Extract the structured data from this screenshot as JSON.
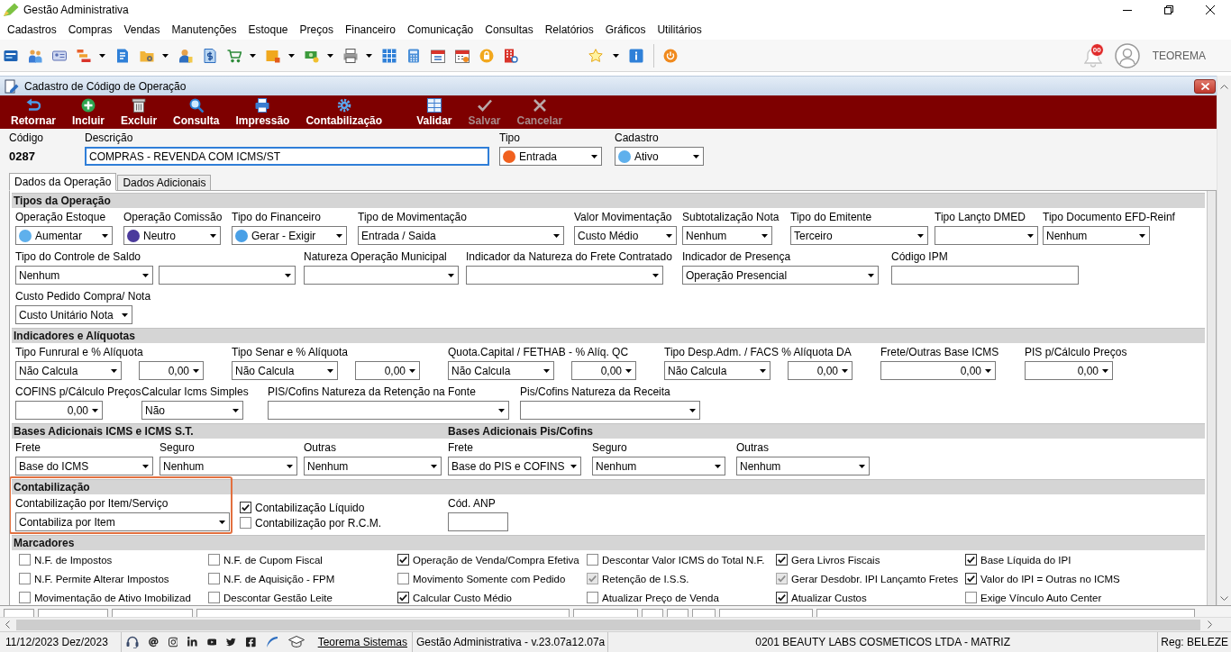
{
  "window": {
    "title": "Gestão Administrativa"
  },
  "menu": [
    "Cadastros",
    "Compras",
    "Vendas",
    "Manutenções",
    "Estoque",
    "Preços",
    "Financeiro",
    "Comunicação",
    "Consultas",
    "Relatórios",
    "Gráficos",
    "Utilitários"
  ],
  "toolbar": {
    "notification_count": "00",
    "user": "TEOREMA"
  },
  "form": {
    "title": "Cadastro de Código de Operação",
    "action_groups": [
      [
        {
          "label": "Retornar",
          "disabled": false
        },
        {
          "label": "Incluir",
          "disabled": false
        },
        {
          "label": "Excluir",
          "disabled": false
        },
        {
          "label": "Consulta",
          "disabled": false
        },
        {
          "label": "Impressão",
          "disabled": false
        },
        {
          "label": "Contabilização",
          "disabled": false
        }
      ],
      [
        {
          "label": "Validar",
          "disabled": false
        },
        {
          "label": "Salvar",
          "disabled": true
        },
        {
          "label": "Cancelar",
          "disabled": true
        }
      ]
    ],
    "code": {
      "label": "Código",
      "value": "0287"
    },
    "description": {
      "label": "Descrição",
      "value": "COMPRAS - REVENDA COM ICMS/ST",
      "focused": true
    },
    "type": {
      "label": "Tipo",
      "value": "Entrada",
      "color": "#f0601e"
    },
    "registry": {
      "label": "Cadastro",
      "value": "Ativo",
      "color": "#5fb0ec"
    },
    "tabs": [
      {
        "label": "Dados da Operação",
        "selected": true
      },
      {
        "label": "Dados Adicionais",
        "selected": false
      }
    ],
    "sections": [
      {
        "kind": "fields",
        "titles": [
          "Tipos da Operação"
        ],
        "lines": [
          {
            "fields": [
              {
                "kind": "field",
                "label": "Operação Estoque",
                "controls": [
                  {
                    "kind": "select",
                    "value": "Aumentar",
                    "color": "#5fb0ec"
                  }
                ]
              },
              {
                "kind": "field",
                "label": "Operação Comissão",
                "controls": [
                  {
                    "kind": "select",
                    "value": "Neutro",
                    "color": "#4b3a9c"
                  }
                ]
              },
              {
                "kind": "field",
                "label": "Tipo do Financeiro",
                "controls": [
                  {
                    "kind": "select",
                    "value": "Gerar - Exigir",
                    "color": "#4aa0e6"
                  }
                ]
              },
              {
                "kind": "field",
                "label": "Tipo de Movimentação",
                "controls": [
                  {
                    "kind": "select",
                    "value": "Entrada / Saida"
                  }
                ]
              },
              {
                "kind": "field",
                "label": "Valor Movimentação",
                "controls": [
                  {
                    "kind": "select",
                    "value": "Custo Médio"
                  }
                ]
              },
              {
                "kind": "field",
                "label": "Subtotalização Nota",
                "controls": [
                  {
                    "kind": "select",
                    "value": "Nenhum"
                  }
                ]
              },
              {
                "kind": "field",
                "label": "Tipo do Emitente",
                "controls": [
                  {
                    "kind": "select",
                    "value": "Terceiro"
                  }
                ]
              },
              {
                "kind": "field",
                "label": "Tipo Lançto DMED",
                "controls": [
                  {
                    "kind": "select"
                  }
                ]
              },
              {
                "kind": "field",
                "label": "Tipo Documento EFD-Reinf",
                "controls": [
                  {
                    "kind": "select",
                    "value": "Nenhum"
                  }
                ]
              }
            ]
          },
          {
            "fields": [
              {
                "kind": "field",
                "label": "Tipo do Controle de Saldo",
                "controls": [
                  {
                    "kind": "select",
                    "value": "Nenhum"
                  },
                  {
                    "kind": "select"
                  }
                ]
              },
              {
                "kind": "field",
                "label": "Natureza Operação Municipal",
                "controls": [
                  {
                    "kind": "select"
                  }
                ]
              },
              {
                "kind": "field",
                "label": "Indicador da Natureza do Frete Contratado",
                "controls": [
                  {
                    "kind": "select"
                  }
                ]
              },
              {
                "kind": "field",
                "label": "Indicador de Presença",
                "controls": [
                  {
                    "kind": "select",
                    "value": "Operação Presencial"
                  }
                ]
              },
              {
                "kind": "field",
                "label": "Código IPM",
                "controls": [
                  {
                    "kind": "text"
                  }
                ]
              }
            ]
          },
          {
            "fields": [
              {
                "kind": "field",
                "label": "Custo Pedido Compra/ Nota",
                "controls": [
                  {
                    "kind": "select",
                    "value": "Custo Unitário Nota"
                  }
                ]
              }
            ]
          }
        ]
      },
      {
        "kind": "fields",
        "titles": [
          "Indicadores e Alíquotas"
        ],
        "lines": [
          {
            "fields": [
              {
                "kind": "field",
                "label": "Tipo Funrural e % Alíquota",
                "controls": [
                  {
                    "kind": "select",
                    "value": "Não Calcula"
                  },
                  {
                    "kind": "number",
                    "value": "0,00"
                  }
                ]
              },
              {
                "kind": "field",
                "label": "Tipo Senar e % Alíquota",
                "controls": [
                  {
                    "kind": "select",
                    "value": "Não Calcula"
                  },
                  {
                    "kind": "number",
                    "value": "0,00"
                  }
                ]
              },
              {
                "kind": "field",
                "label": "Quota.Capital / FETHAB - % Alíq. QC",
                "controls": [
                  {
                    "kind": "select",
                    "value": "Não Calcula"
                  },
                  {
                    "kind": "number",
                    "value": "0,00"
                  }
                ]
              },
              {
                "kind": "field",
                "label": "Tipo Desp.Adm. / FACS % Alíquota DA",
                "controls": [
                  {
                    "kind": "select",
                    "value": "Não Calcula"
                  },
                  {
                    "kind": "number",
                    "value": "0,00"
                  }
                ]
              },
              {
                "kind": "field",
                "label": "Frete/Outras Base ICMS",
                "controls": [
                  {
                    "kind": "number",
                    "value": "0,00"
                  }
                ]
              },
              {
                "kind": "field",
                "label": "PIS p/Cálculo Preços",
                "controls": [
                  {
                    "kind": "number",
                    "value": "0,00"
                  }
                ]
              }
            ]
          },
          {
            "fields": [
              {
                "kind": "field",
                "label": "COFINS p/Cálculo Preços",
                "controls": [
                  {
                    "kind": "number",
                    "value": "0,00"
                  }
                ]
              },
              {
                "kind": "field",
                "label": "Calcular Icms Simples",
                "controls": [
                  {
                    "kind": "select",
                    "value": "Não"
                  }
                ]
              },
              {
                "kind": "field",
                "label": "PIS/Cofins Natureza da Retenção na Fonte",
                "controls": [
                  {
                    "kind": "select"
                  }
                ]
              },
              {
                "kind": "field",
                "label": "Pis/Cofins Natureza da Receita",
                "controls": [
                  {
                    "kind": "select"
                  }
                ]
              }
            ]
          }
        ]
      },
      {
        "kind": "fields",
        "titles": [
          "Bases Adicionais ICMS e ICMS S.T.",
          "Bases Adicionais Pis/Cofins"
        ],
        "lines": [
          {
            "fields": [
              {
                "kind": "field",
                "label": "Frete",
                "controls": [
                  {
                    "kind": "select",
                    "value": "Base do ICMS"
                  }
                ]
              },
              {
                "kind": "field",
                "label": "Seguro",
                "controls": [
                  {
                    "kind": "select",
                    "value": "Nenhum"
                  }
                ]
              },
              {
                "kind": "field",
                "label": "Outras",
                "controls": [
                  {
                    "kind": "select",
                    "value": "Nenhum"
                  }
                ]
              },
              {
                "kind": "field",
                "label": "Frete",
                "controls": [
                  {
                    "kind": "select",
                    "value": "Base do PIS e COFINS"
                  }
                ]
              },
              {
                "kind": "field",
                "label": "Seguro",
                "controls": [
                  {
                    "kind": "select",
                    "value": "Nenhum"
                  }
                ]
              },
              {
                "kind": "field",
                "label": "Outras",
                "controls": [
                  {
                    "kind": "select",
                    "value": "Nenhum"
                  }
                ]
              }
            ]
          }
        ]
      },
      {
        "kind": "fields",
        "titles": [
          "Contabilização"
        ],
        "highlight": true,
        "lines": [
          {
            "fields": [
              {
                "kind": "field",
                "label": "Contabilização por Item/Serviço",
                "controls": [
                  {
                    "kind": "select",
                    "value": "Contabiliza por Item"
                  }
                ]
              },
              {
                "kind": "checks",
                "items": [
                  {
                    "label": "Contabilização Líquido",
                    "checked": true
                  },
                  {
                    "label": "Contabilização por R.C.M.",
                    "checked": false
                  }
                ]
              },
              {
                "kind": "field",
                "label": "Cód. ANP",
                "controls": [
                  {
                    "kind": "text"
                  }
                ]
              }
            ]
          }
        ]
      },
      {
        "kind": "checkbox_grid",
        "titles": [
          "Marcadores"
        ],
        "rows": [
          [
            {
              "label": "N.F. de Impostos",
              "checked": false,
              "disabled": false
            },
            {
              "label": "N.F. de Cupom Fiscal",
              "checked": false,
              "disabled": false
            },
            {
              "label": "Operação de Venda/Compra Efetiva",
              "checked": true,
              "disabled": false
            },
            {
              "label": "Descontar Valor ICMS do Total N.F.",
              "checked": false,
              "disabled": false
            },
            {
              "label": "Gera Livros Fiscais",
              "checked": true,
              "disabled": false
            },
            {
              "label": "Base Líquida do IPI",
              "checked": true,
              "disabled": false
            }
          ],
          [
            {
              "label": "N.F. Permite Alterar Impostos",
              "checked": false,
              "disabled": false
            },
            {
              "label": "N.F. de Aquisição - FPM",
              "checked": false,
              "disabled": false
            },
            {
              "label": "Movimento Somente com Pedido",
              "checked": false,
              "disabled": false
            },
            {
              "label": "Retenção de I.S.S.",
              "checked": true,
              "disabled": true
            },
            {
              "label": "Gerar Desdobr. IPI Lançamto Fretes",
              "checked": true,
              "disabled": true
            },
            {
              "label": "Valor do IPI = Outras no ICMS",
              "checked": true,
              "disabled": false
            }
          ],
          [
            {
              "label": "Movimentação de Ativo Imobilizad",
              "checked": false,
              "disabled": false
            },
            {
              "label": "Descontar Gestão Leite",
              "checked": false,
              "disabled": false
            },
            {
              "label": "Calcular Custo Médio",
              "checked": true,
              "disabled": false
            },
            {
              "label": "Atualizar Preço de Venda",
              "checked": false,
              "disabled": false
            },
            {
              "label": "Atualizar Custos",
              "checked": true,
              "disabled": false
            },
            {
              "label": "Exige Vínculo Auto Center",
              "checked": false,
              "disabled": false
            }
          ]
        ]
      }
    ]
  },
  "status_bar": {
    "date": "11/12/2023 Dez/2023",
    "link": "Teorema Sistemas",
    "version": "Gestão Administrativa - v.23.07a12.07a",
    "company": "0201 BEAUTY LABS COSMETICOS LTDA - MATRIZ",
    "registration": "Reg: BELEZE"
  }
}
